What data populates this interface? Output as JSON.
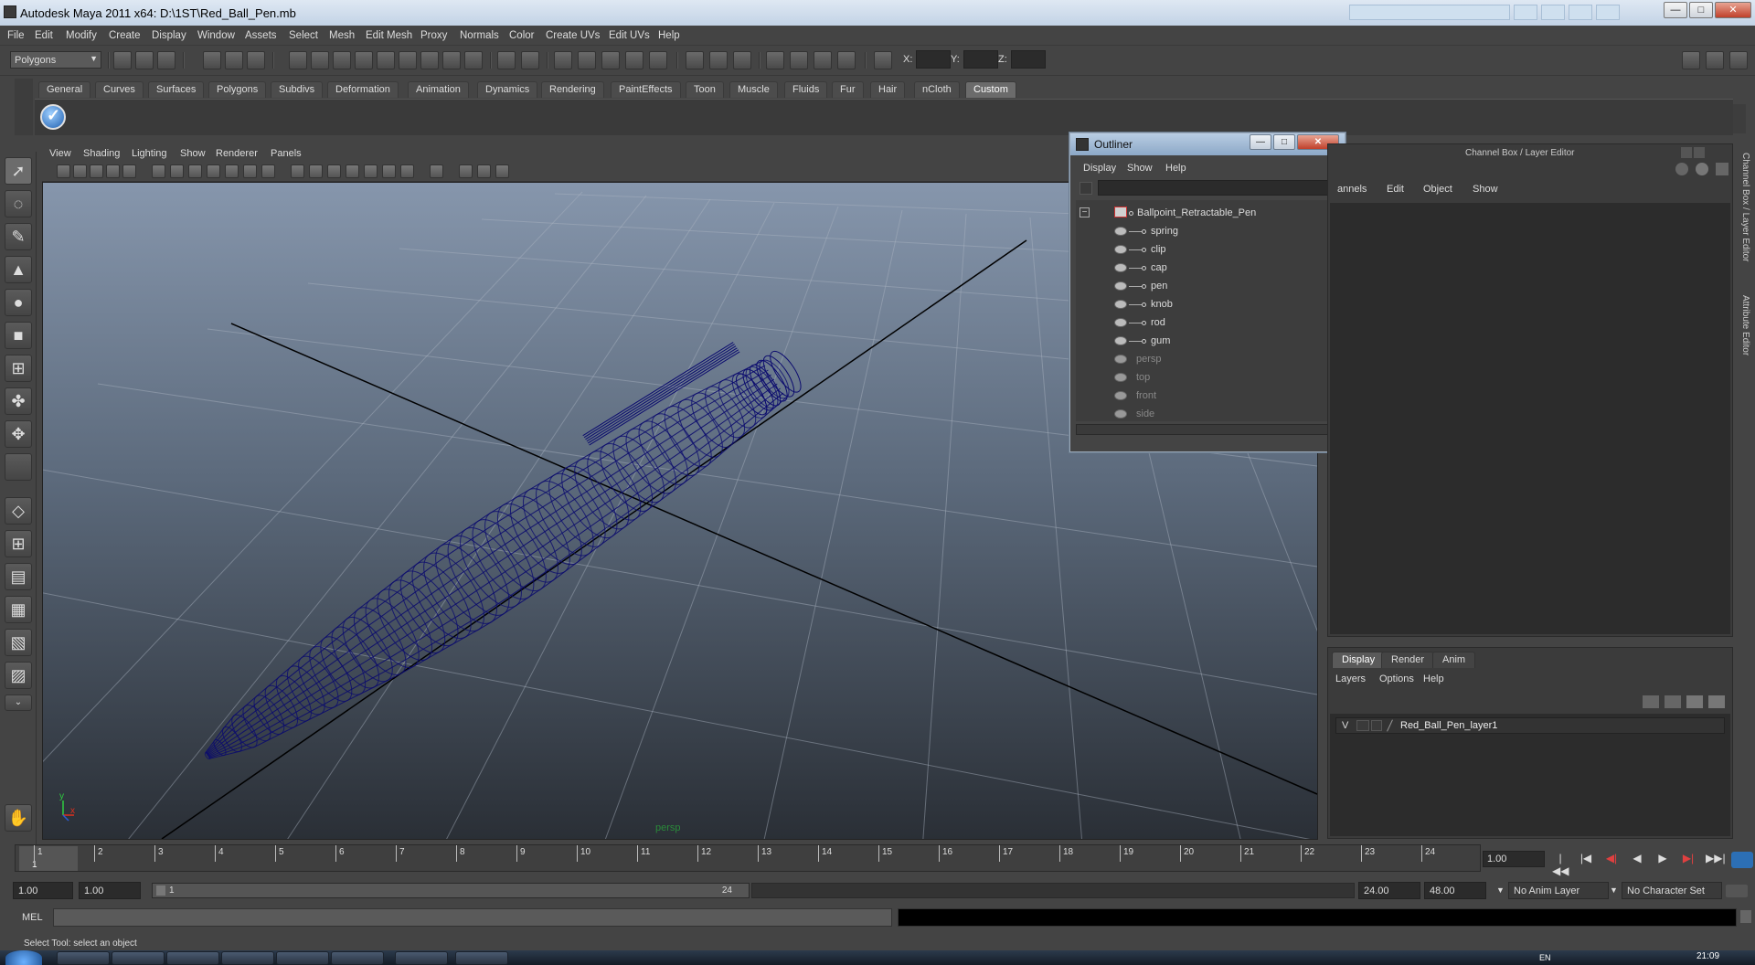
{
  "window": {
    "title": "Autodesk Maya 2011 x64: D:\\1ST\\Red_Ball_Pen.mb",
    "min_label": "—",
    "max_label": "□",
    "close_label": "✕"
  },
  "menubar": [
    "File",
    "Edit",
    "Modify",
    "Create",
    "Display",
    "Window",
    "Assets",
    "Select",
    "Mesh",
    "Edit Mesh",
    "Proxy",
    "Normals",
    "Color",
    "Create UVs",
    "Edit UVs",
    "Help"
  ],
  "status_line": {
    "mode": "Polygons",
    "x_label": "X:",
    "y_label": "Y:",
    "z_label": "Z:"
  },
  "shelf": {
    "tabs": [
      "General",
      "Curves",
      "Surfaces",
      "Polygons",
      "Subdivs",
      "Deformation",
      "Animation",
      "Dynamics",
      "Rendering",
      "PaintEffects",
      "Toon",
      "Muscle",
      "Fluids",
      "Fur",
      "Hair",
      "nCloth",
      "Custom"
    ],
    "active_tab": "Custom",
    "icon_glyph": "✓"
  },
  "viewport": {
    "menu": [
      "View",
      "Shading",
      "Lighting",
      "Show",
      "Renderer",
      "Panels"
    ],
    "camera_label": "persp",
    "wire_color": "#0b0b6e",
    "axis_x": "x",
    "axis_y": "y"
  },
  "outliner": {
    "title": "Outliner",
    "min_label": "—",
    "max_label": "□",
    "close_label": "✕",
    "menu": [
      "Display",
      "Show",
      "Help"
    ],
    "root": "Ballpoint_Retractable_Pen",
    "children": [
      "spring",
      "clip",
      "cap",
      "pen",
      "knob",
      "rod",
      "gum"
    ],
    "cameras": [
      "persp",
      "top",
      "front",
      "side"
    ]
  },
  "channel_box": {
    "title": "Channel Box / Layer Editor",
    "menu": [
      "annels",
      "Edit",
      "Object",
      "Show"
    ],
    "side_labels": [
      "Channel Box / Layer Editor",
      "Attribute Editor"
    ]
  },
  "layer_editor": {
    "tabs": [
      "Display",
      "Render",
      "Anim"
    ],
    "active_tab": "Display",
    "menu": [
      "Layers",
      "Options",
      "Help"
    ],
    "layer": {
      "visible": "V",
      "name": "Red_Ball_Pen_layer1"
    }
  },
  "time_slider": {
    "ticks": [
      1,
      2,
      3,
      4,
      5,
      6,
      7,
      8,
      9,
      10,
      11,
      12,
      13,
      14,
      15,
      16,
      17,
      18,
      19,
      20,
      21,
      22,
      23,
      24
    ],
    "current_frame": "1",
    "current_frame_field": "1.00",
    "playback_glyphs": [
      "|◀◀",
      "|◀",
      "◀|",
      "◀",
      "▶",
      "▶|",
      "▶▶|"
    ]
  },
  "range": {
    "start_time": "1.00",
    "playback_start": "1.00",
    "range_start_label": "1",
    "range_end_label": "24",
    "playback_end": "24.00",
    "end_time": "48.00",
    "anim_layer": "No Anim Layer",
    "character_set": "No Character Set"
  },
  "command_line": {
    "label": "MEL",
    "help": "Select Tool: select an object"
  },
  "taskbar": {
    "lang": "EN",
    "clock": "21:09"
  }
}
